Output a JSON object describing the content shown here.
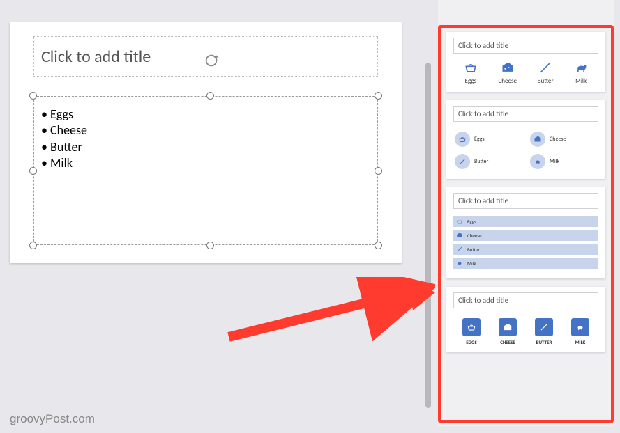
{
  "slide": {
    "title_placeholder": "Click to add title",
    "bullets": [
      "Eggs",
      "Cheese",
      "Butter",
      "Milk"
    ]
  },
  "ideas": {
    "title_placeholder": "Click to add title",
    "items": [
      {
        "label": "Eggs",
        "icon": "basket"
      },
      {
        "label": "Cheese",
        "icon": "cheese"
      },
      {
        "label": "Butter",
        "icon": "knife"
      },
      {
        "label": "Milk",
        "icon": "cow"
      }
    ],
    "items_upper": [
      {
        "label": "EGGS"
      },
      {
        "label": "CHEESE"
      },
      {
        "label": "BUTTER"
      },
      {
        "label": "MILK"
      }
    ]
  },
  "watermark": "groovyPost.com",
  "colors": {
    "accent": "#4472c4",
    "highlight": "#ff3b30"
  }
}
